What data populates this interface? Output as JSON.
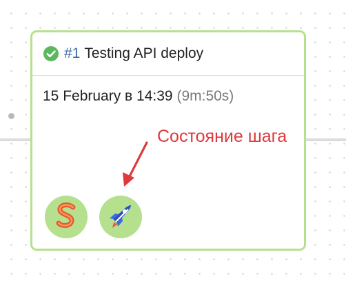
{
  "run": {
    "number": "#1",
    "title": "Testing API deploy",
    "datetime": "15 February в 14:39",
    "duration": "(9m:50s)",
    "status_icon": "check-circle-icon",
    "status_color": "#5cb85c"
  },
  "steps": [
    {
      "name": "sentry-step",
      "icon": "s-logo-icon"
    },
    {
      "name": "deploy-step",
      "icon": "rocket-icon"
    }
  ],
  "annotation": {
    "text": "Состояние шага",
    "color": "#e0383b"
  },
  "colors": {
    "card_border": "#b5e08d",
    "step_bg": "#b5e08d",
    "run_number": "#3a6ea5"
  }
}
